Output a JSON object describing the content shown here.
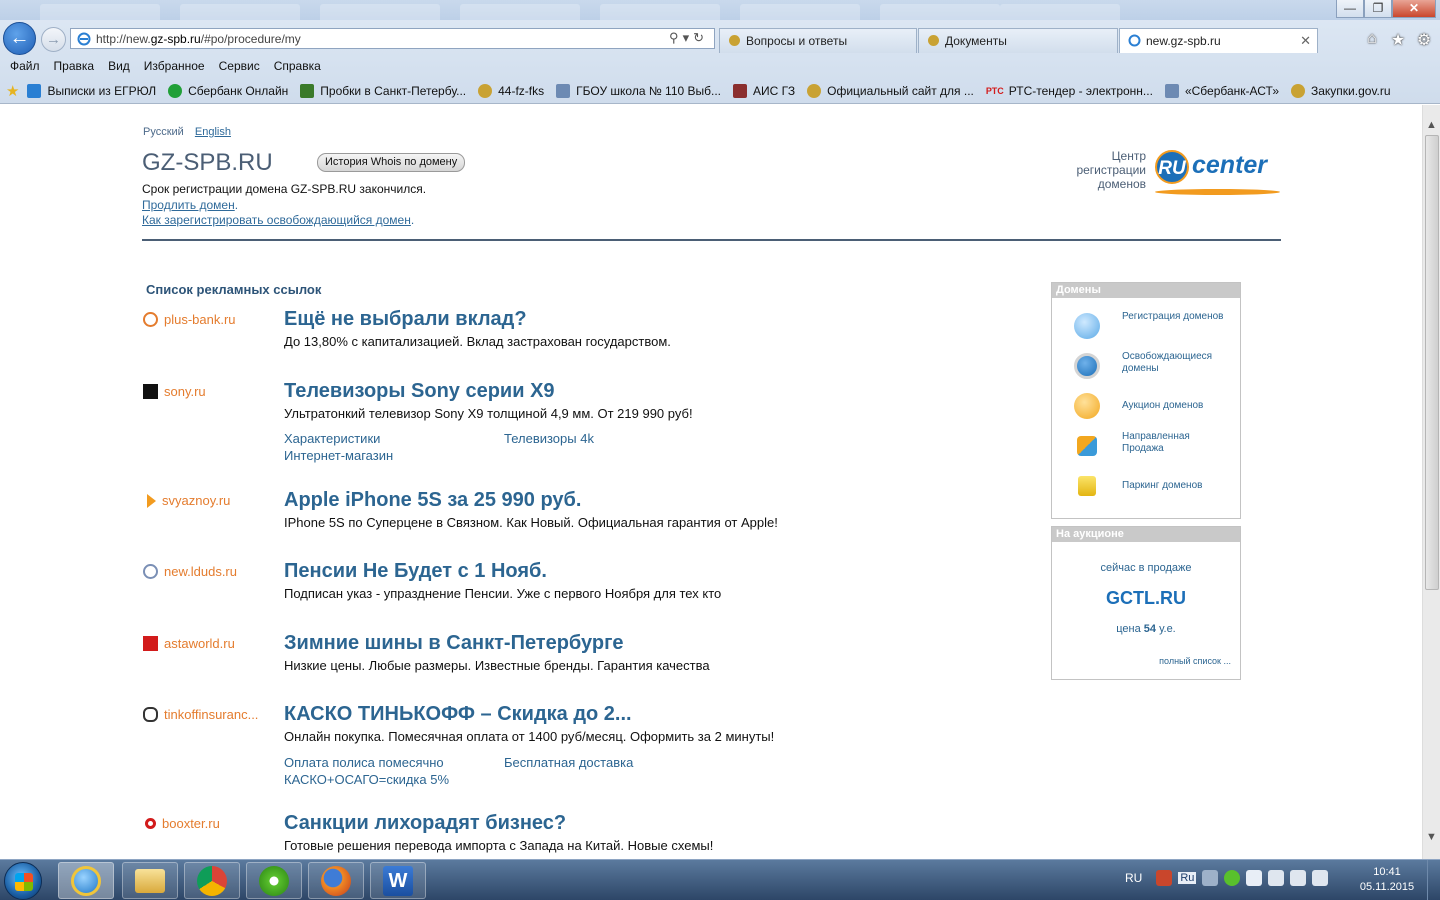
{
  "browser": {
    "url_prefix": "http://new.",
    "url_domain": "gz-spb.ru",
    "url_rest": "/#po/procedure/my",
    "tabs": [
      {
        "label": "Вопросы и ответы"
      },
      {
        "label": "Документы"
      },
      {
        "label": "new.gz-spb.ru"
      }
    ],
    "menu": [
      "Файл",
      "Правка",
      "Вид",
      "Избранное",
      "Сервис",
      "Справка"
    ],
    "favorites": [
      {
        "label": "Выписки из ЕГРЮЛ",
        "color": "#2a7fd3"
      },
      {
        "label": "Сбербанк Онлайн",
        "color": "#21a038"
      },
      {
        "label": "Пробки в Санкт-Петербу...",
        "color": "#3a7a2a"
      },
      {
        "label": "44-fz-fks",
        "color": "#c9a233"
      },
      {
        "label": "ГБОУ школа № 110 Выб...",
        "color": "#6d8ab3"
      },
      {
        "label": "АИС ГЗ",
        "color": "#8b2e2e"
      },
      {
        "label": "Официальный сайт для ...",
        "color": "#c9a233"
      },
      {
        "label": "РТС-тендер - электронн...",
        "color": "#d21b1b",
        "prefix": "РТС"
      },
      {
        "label": "«Сбербанк-АСТ»",
        "color": "#6d8ab3"
      },
      {
        "label": "Закупки.gov.ru",
        "color": "#c9a233"
      }
    ]
  },
  "page": {
    "lang_ru": "Русский",
    "lang_en": "English",
    "domain": "GZ-SPB.RU",
    "whois_button": "История Whois по домену",
    "expired_text": "Срок регистрации домена GZ-SPB.RU закончился.",
    "renew_link": "Продлить домен",
    "register_link": "Как зарегистрировать освобождающийся домен",
    "rucenter_caption": [
      "Центр",
      "регистрации",
      "доменов"
    ],
    "rucenter_ru": "RU",
    "rucenter_center": "center",
    "ads_header": "Список рекламных ссылок"
  },
  "ads": [
    {
      "domain": "plus-bank.ru",
      "title": "Ещё не выбрали вклад?",
      "desc": "До 13,80% с капитализацией. Вклад застрахован государством.",
      "icon_color": "#e47c2e"
    },
    {
      "domain": "sony.ru",
      "title": "Телевизоры Sony серии X9",
      "desc": "Ультратонкий телевизор Sony X9 толщиной 4,9 мм. От 219 990 руб!",
      "icon_color": "#111111",
      "links": [
        "Характеристики",
        "Телевизоры 4k",
        "Интернет-магазин"
      ]
    },
    {
      "domain": "svyaznoy.ru",
      "title": "Apple iPhone 5S за 25 990 руб.",
      "desc": "IPhone 5S по Суперцене в Связном. Как Новый. Официальная гарантия от Apple!",
      "icon_color": "#f29b1f"
    },
    {
      "domain": "new.lduds.ru",
      "title": "Пенсии Не Будет с 1 Нояб.",
      "desc": "Подписан указ - упразднение Пенсии. Уже с первого Ноября для тех кто",
      "icon_color": "#7a8fb5"
    },
    {
      "domain": "astaworld.ru",
      "title": "Зимние шины в Санкт-Петербурге",
      "desc": "Низкие цены. Любые размеры. Известные бренды. Гарантия качества",
      "icon_color": "#d21b1b"
    },
    {
      "domain": "tinkoffinsuranc...",
      "title": "КАСКО ТИНЬКОФФ – Скидка до 2...",
      "desc": "Онлайн покупка. Помесячная оплата от 1400 руб/месяц. Оформить за 2 минуты!",
      "icon_color": "#333333",
      "links": [
        "Оплата полиса помесячно",
        "Бесплатная доставка",
        "КАСКО+ОСАГО=скидка 5%"
      ]
    },
    {
      "domain": "booxter.ru",
      "title": "Санкции лихорадят бизнес?",
      "desc": "Готовые решения перевода импорта с Запада на Китай. Новые схемы!",
      "icon_color": "#d21b1b"
    }
  ],
  "sidebar": {
    "domains_header": "Домены",
    "services": [
      {
        "label": "Регистрация доменов",
        "color": "#5aa9e6"
      },
      {
        "label": "Освобождающиеся домены",
        "color": "#1c6fb8"
      },
      {
        "label": "Аукцион доменов",
        "color": "#f2a71f"
      },
      {
        "label": "Направленная Продажа",
        "color": "#e07a2a"
      },
      {
        "label": "Паркинг доменов",
        "color": "#e8c21f"
      }
    ],
    "auction_header": "На аукционе",
    "on_sale": "сейчас в продаже",
    "auction_domain": "GCTL.RU",
    "price_prefix": "цена",
    "price_value": "54",
    "price_suffix": "у.е.",
    "full_list": "полный список ..."
  },
  "taskbar": {
    "lang": "RU",
    "tray_lang": "Ru",
    "time": "10:41",
    "date": "05.11.2015"
  }
}
